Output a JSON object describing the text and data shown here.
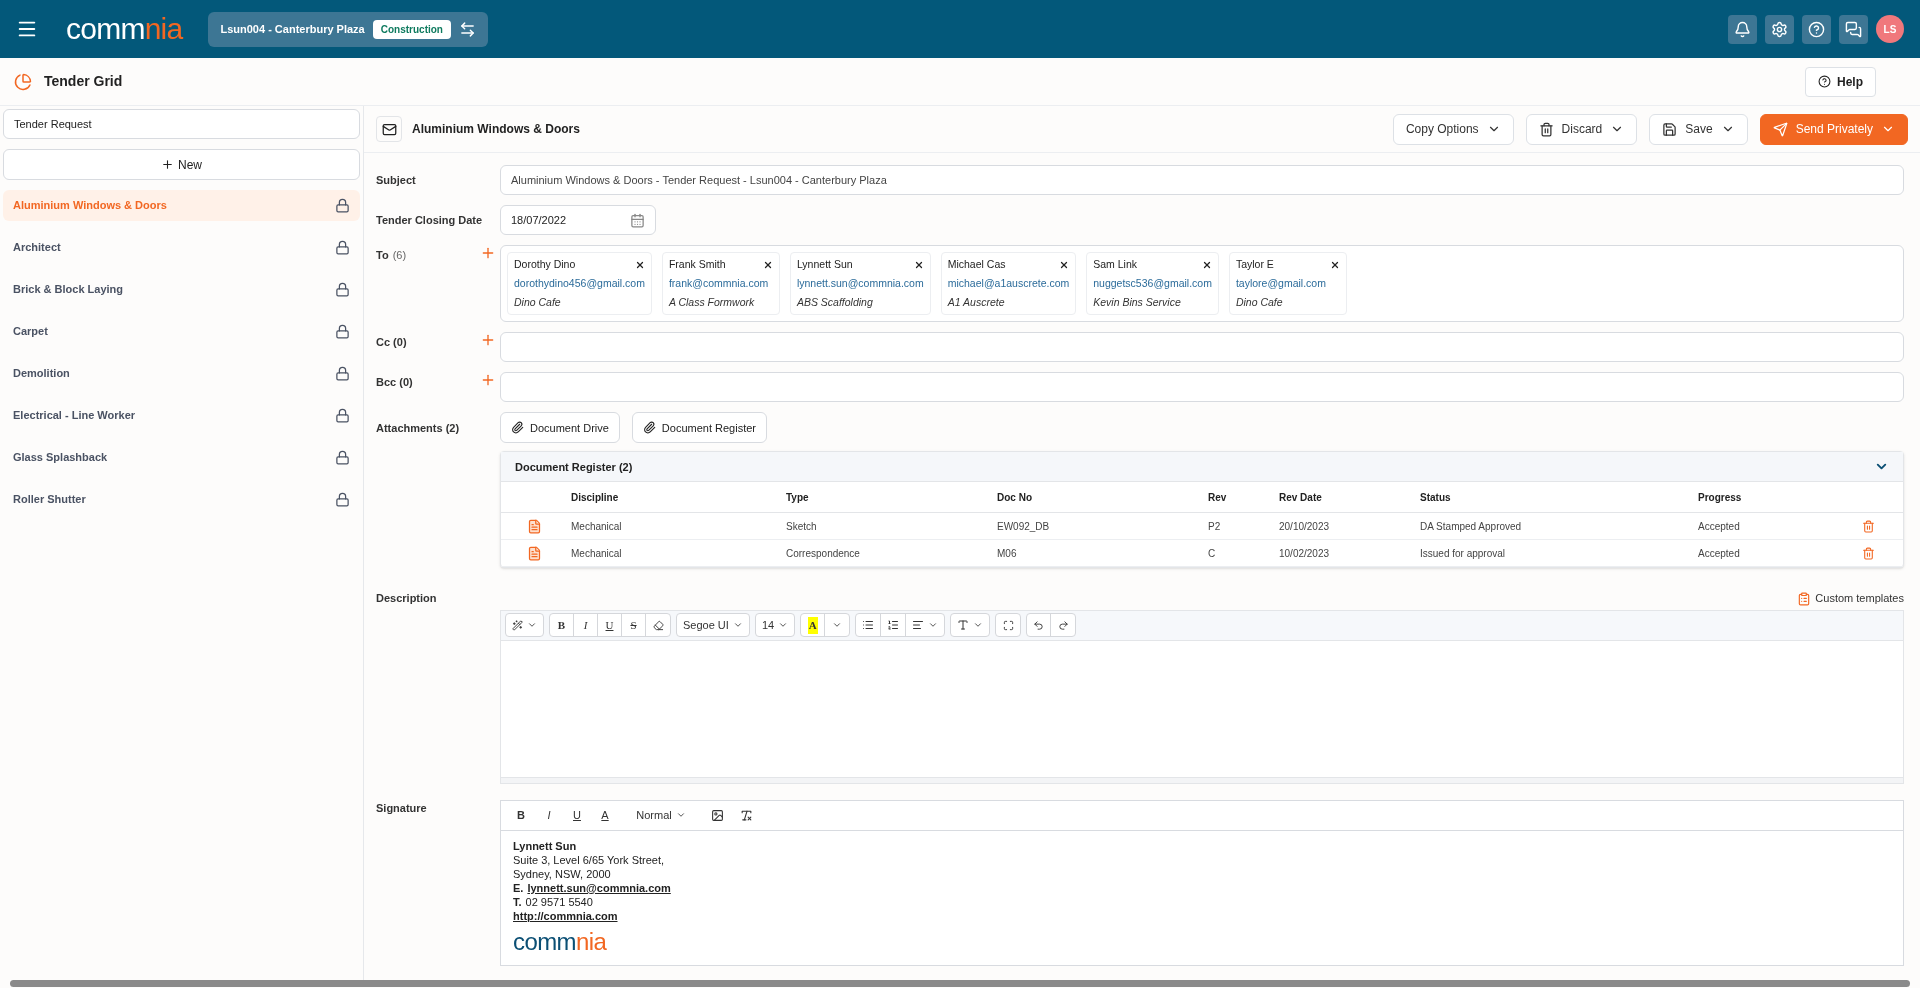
{
  "topbar": {
    "logo": {
      "primary": "comm",
      "accent": "nia"
    },
    "project": {
      "name": "Lsun004 - Canterbury Plaza",
      "badge": "Construction"
    },
    "avatar": "LS"
  },
  "page": {
    "title": "Tender Grid",
    "help": "Help"
  },
  "sidebar": {
    "search": {
      "value": "Tender Request"
    },
    "new_button": "New",
    "items": [
      {
        "label": "Aluminium Windows & Doors",
        "selected": true
      },
      {
        "label": "Architect",
        "selected": false
      },
      {
        "label": "Brick & Block Laying",
        "selected": false
      },
      {
        "label": "Carpet",
        "selected": false
      },
      {
        "label": "Demolition",
        "selected": false
      },
      {
        "label": "Electrical - Line Worker",
        "selected": false
      },
      {
        "label": "Glass Splashback",
        "selected": false
      },
      {
        "label": "Roller Shutter",
        "selected": false
      }
    ]
  },
  "header": {
    "title": "Aluminium Windows & Doors",
    "actions": [
      {
        "label": "Copy Options",
        "kind": "plain"
      },
      {
        "label": "Discard",
        "kind": "trash"
      },
      {
        "label": "Save",
        "kind": "save"
      },
      {
        "label": "Send Privately",
        "kind": "send"
      }
    ]
  },
  "form": {
    "subject": {
      "label": "Subject",
      "value": "Aluminium Windows & Doors - Tender Request - Lsun004 - Canterbury Plaza"
    },
    "closing_date": {
      "label": "Tender Closing Date",
      "value": "18/07/2022"
    },
    "to": {
      "label": "To",
      "count": "(6)",
      "recipients": [
        {
          "name": "Dorothy Dino",
          "email": "dorothydino456@gmail.com",
          "company": "Dino Cafe"
        },
        {
          "name": "Frank Smith",
          "email": "frank@commnia.com",
          "company": "A Class Formwork"
        },
        {
          "name": "Lynnett Sun",
          "email": "lynnett.sun@commnia.com",
          "company": "ABS Scaffolding"
        },
        {
          "name": "Michael Cas",
          "email": "michael@a1auscrete.com",
          "company": "A1 Auscrete"
        },
        {
          "name": "Sam Link",
          "email": "nuggetsc536@gmail.com",
          "company": "Kevin Bins Service"
        },
        {
          "name": "Taylor E",
          "email": "taylore@gmail.com",
          "company": "Dino Cafe"
        }
      ]
    },
    "cc": {
      "label": "Cc (0)"
    },
    "bcc": {
      "label": "Bcc (0)"
    },
    "attachments": {
      "label": "Attachments (2)",
      "buttons": [
        "Document Drive",
        "Document Register"
      ],
      "register": {
        "title": "Document Register (2)",
        "expanded": true,
        "columns": [
          "Discipline",
          "Type",
          "Doc No",
          "Rev",
          "Rev Date",
          "Status",
          "Progress"
        ],
        "rows": [
          [
            "Mechanical",
            "Sketch",
            "EW092_DB",
            "P2",
            "20/10/2023",
            "DA Stamped Approved",
            "Accepted"
          ],
          [
            "Mechanical",
            "Correspondence",
            "M06",
            "C",
            "10/02/2023",
            "Issued for approval",
            "Accepted"
          ]
        ]
      }
    },
    "description": {
      "label": "Description",
      "templates": "Custom templates",
      "toolbar": {
        "bold": "B",
        "italic": "I",
        "underline": "U",
        "strike": "S",
        "font": "Segoe UI",
        "size": "14",
        "highlight": "A"
      }
    },
    "signature": {
      "label": "Signature",
      "toolbar": {
        "bold": "B",
        "italic": "I",
        "underline": "U",
        "font_colour_letter": "A",
        "format": "Normal"
      },
      "content": {
        "name": "Lynnett Sun",
        "address": [
          "Suite 3, Level 6/65 York Street,",
          "Sydney, NSW, 2000"
        ],
        "email_label": "E.",
        "email": "lynnett.sun@commnia.com",
        "phone_label": "T.",
        "phone": "02 9571 5540",
        "website": "http://commnia.com",
        "logo": {
          "primary": "comm",
          "accent": "nia"
        }
      }
    }
  }
}
